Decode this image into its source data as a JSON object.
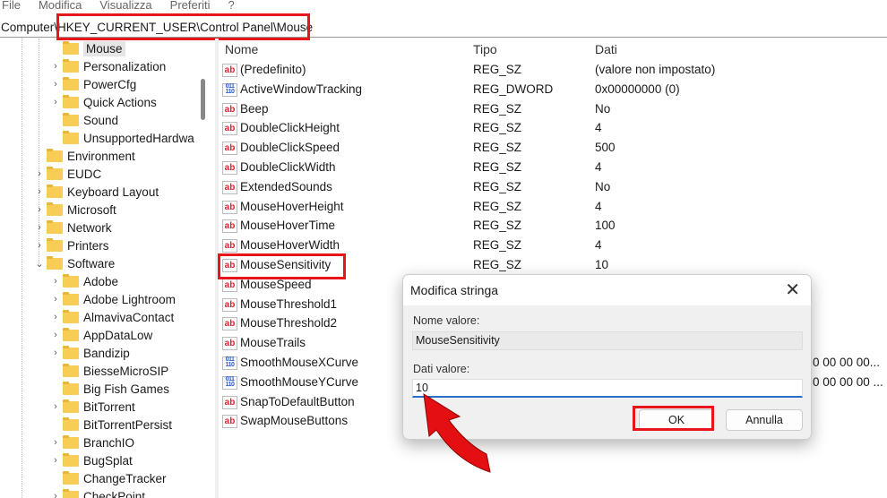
{
  "menu": [
    "File",
    "Modifica",
    "Visualizza",
    "Preferiti",
    "?"
  ],
  "address": {
    "prefix": "Computer\\",
    "path": "HKEY_CURRENT_USER\\Control Panel\\Mouse"
  },
  "tree": [
    {
      "label": "Mouse",
      "level": 3,
      "chev": "",
      "selected": true
    },
    {
      "label": "Personalization",
      "level": 3,
      "chev": "›"
    },
    {
      "label": "PowerCfg",
      "level": 3,
      "chev": "›"
    },
    {
      "label": "Quick Actions",
      "level": 3,
      "chev": "›"
    },
    {
      "label": "Sound",
      "level": 3,
      "chev": ""
    },
    {
      "label": "UnsupportedHardwa",
      "level": 3,
      "chev": ""
    },
    {
      "label": "Environment",
      "level": 2,
      "chev": ""
    },
    {
      "label": "EUDC",
      "level": 2,
      "chev": "›"
    },
    {
      "label": "Keyboard Layout",
      "level": 2,
      "chev": "›"
    },
    {
      "label": "Microsoft",
      "level": 2,
      "chev": "›"
    },
    {
      "label": "Network",
      "level": 2,
      "chev": "›"
    },
    {
      "label": "Printers",
      "level": 2,
      "chev": "›"
    },
    {
      "label": "Software",
      "level": 2,
      "chev": "⌄"
    },
    {
      "label": "Adobe",
      "level": 3,
      "chev": "›"
    },
    {
      "label": "Adobe Lightroom",
      "level": 3,
      "chev": "›"
    },
    {
      "label": "AlmavivaContact",
      "level": 3,
      "chev": "›"
    },
    {
      "label": "AppDataLow",
      "level": 3,
      "chev": "›"
    },
    {
      "label": "Bandizip",
      "level": 3,
      "chev": "›"
    },
    {
      "label": "BiesseMicroSIP",
      "level": 3,
      "chev": ""
    },
    {
      "label": "Big Fish Games",
      "level": 3,
      "chev": ""
    },
    {
      "label": "BitTorrent",
      "level": 3,
      "chev": "›"
    },
    {
      "label": "BitTorrentPersist",
      "level": 3,
      "chev": ""
    },
    {
      "label": "BranchIO",
      "level": 3,
      "chev": "›"
    },
    {
      "label": "BugSplat",
      "level": 3,
      "chev": "›"
    },
    {
      "label": "ChangeTracker",
      "level": 3,
      "chev": ""
    },
    {
      "label": "CheckPoint",
      "level": 3,
      "chev": "›"
    }
  ],
  "columns": {
    "name": "Nome",
    "type": "Tipo",
    "data": "Dati"
  },
  "values": [
    {
      "name": "(Predefinito)",
      "icon": "ab",
      "type": "REG_SZ",
      "data": "(valore non impostato)"
    },
    {
      "name": "ActiveWindowTracking",
      "icon": "bin",
      "type": "REG_DWORD",
      "data": "0x00000000 (0)"
    },
    {
      "name": "Beep",
      "icon": "ab",
      "type": "REG_SZ",
      "data": "No"
    },
    {
      "name": "DoubleClickHeight",
      "icon": "ab",
      "type": "REG_SZ",
      "data": "4"
    },
    {
      "name": "DoubleClickSpeed",
      "icon": "ab",
      "type": "REG_SZ",
      "data": "500"
    },
    {
      "name": "DoubleClickWidth",
      "icon": "ab",
      "type": "REG_SZ",
      "data": "4"
    },
    {
      "name": "ExtendedSounds",
      "icon": "ab",
      "type": "REG_SZ",
      "data": "No"
    },
    {
      "name": "MouseHoverHeight",
      "icon": "ab",
      "type": "REG_SZ",
      "data": "4"
    },
    {
      "name": "MouseHoverTime",
      "icon": "ab",
      "type": "REG_SZ",
      "data": "100"
    },
    {
      "name": "MouseHoverWidth",
      "icon": "ab",
      "type": "REG_SZ",
      "data": "4"
    },
    {
      "name": "MouseSensitivity",
      "icon": "ab",
      "type": "REG_SZ",
      "data": "10"
    },
    {
      "name": "MouseSpeed",
      "icon": "ab"
    },
    {
      "name": "MouseThreshold1",
      "icon": "ab"
    },
    {
      "name": "MouseThreshold2",
      "icon": "ab"
    },
    {
      "name": "MouseTrails",
      "icon": "ab"
    },
    {
      "name": "SmoothMouseXCurve",
      "icon": "bin",
      "data": "0 00 00 00..."
    },
    {
      "name": "SmoothMouseYCurve",
      "icon": "bin",
      "data": "0 00 00 00 ..."
    },
    {
      "name": "SnapToDefaultButton",
      "icon": "ab"
    },
    {
      "name": "SwapMouseButtons",
      "icon": "ab"
    }
  ],
  "dialog": {
    "title": "Modifica stringa",
    "name_label": "Nome valore:",
    "name_value": "MouseSensitivity",
    "data_label": "Dati valore:",
    "data_value": "10",
    "ok": "OK",
    "cancel": "Annulla"
  },
  "colors": {
    "highlight": "#e8161b"
  }
}
